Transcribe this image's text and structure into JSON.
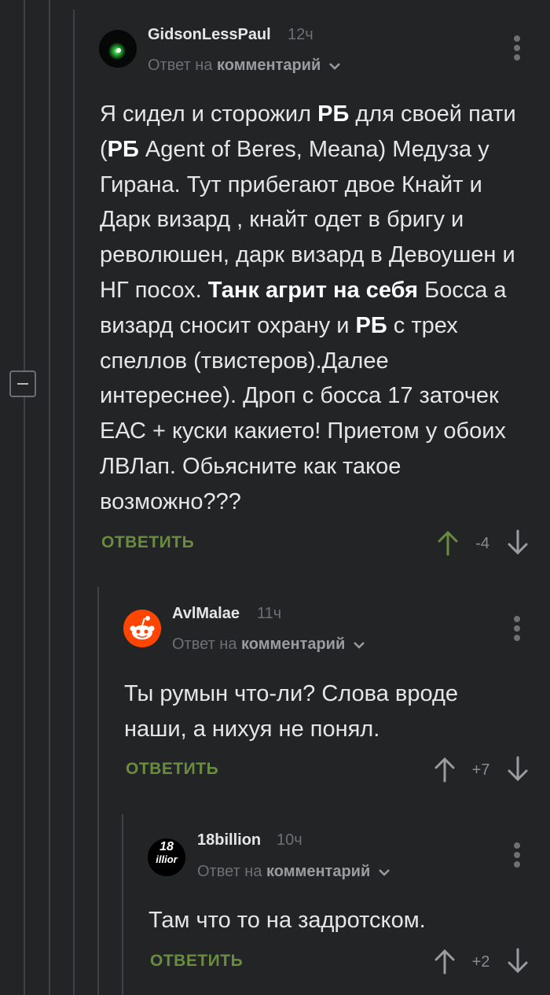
{
  "comments": [
    {
      "username": "GidsonLessPaul",
      "time": "12ч",
      "reply_prefix": "Ответ на",
      "reply_target": "комментарий",
      "body": [
        {
          "t": "Я сидел и сторожил ",
          "b": false
        },
        {
          "t": "РБ",
          "b": true
        },
        {
          "t": " для своей пати (",
          "b": false
        },
        {
          "t": "РБ",
          "b": true
        },
        {
          "t": " Agent of Beres, Meana) Медуза у Гирана. Тут прибегают двое Кнайт и Дарк визард , кнайт одет в бригу и революшен, дарк визард в Девоушен и НГ посох. ",
          "b": false
        },
        {
          "t": "Танк агрит на себя",
          "b": true
        },
        {
          "t": " Босса а визард сносит охрану и ",
          "b": false
        },
        {
          "t": "РБ",
          "b": true
        },
        {
          "t": " с трех спеллов (твистеров).Далее интереснее). Дроп с босса 17 заточек ЕАС + куски какието! Приетом у обоих ЛВЛап. Обьясните как такое возможно???",
          "b": false
        }
      ],
      "reply_label": "ОТВЕТИТЬ",
      "score": "-4",
      "avatar_icon": "green-orb-avatar"
    },
    {
      "username": "AvlMalae",
      "time": "11ч",
      "reply_prefix": "Ответ на",
      "reply_target": "комментарий",
      "body": [
        {
          "t": "Ты румын что-ли? Слова вроде наши, а нихуя не понял.",
          "b": false
        }
      ],
      "reply_label": "ОТВЕТИТЬ",
      "score": "+7",
      "avatar_icon": "reddit-alien-avatar"
    },
    {
      "username": "18billion",
      "time": "10ч",
      "reply_prefix": "Ответ на",
      "reply_target": "комментарий",
      "body": [
        {
          "t": "Там что то на задротском.",
          "b": false
        }
      ],
      "reply_label": "ОТВЕТИТЬ",
      "score": "+2",
      "avatar_icon": "18-billion-avatar",
      "avatar_text_top": "18",
      "avatar_text_bottom": "illior"
    }
  ],
  "colors": {
    "background": "#222426",
    "reply_link": "#6a8c3f",
    "upvote_active": "#6a8c3f",
    "muted": "#6d7074"
  }
}
